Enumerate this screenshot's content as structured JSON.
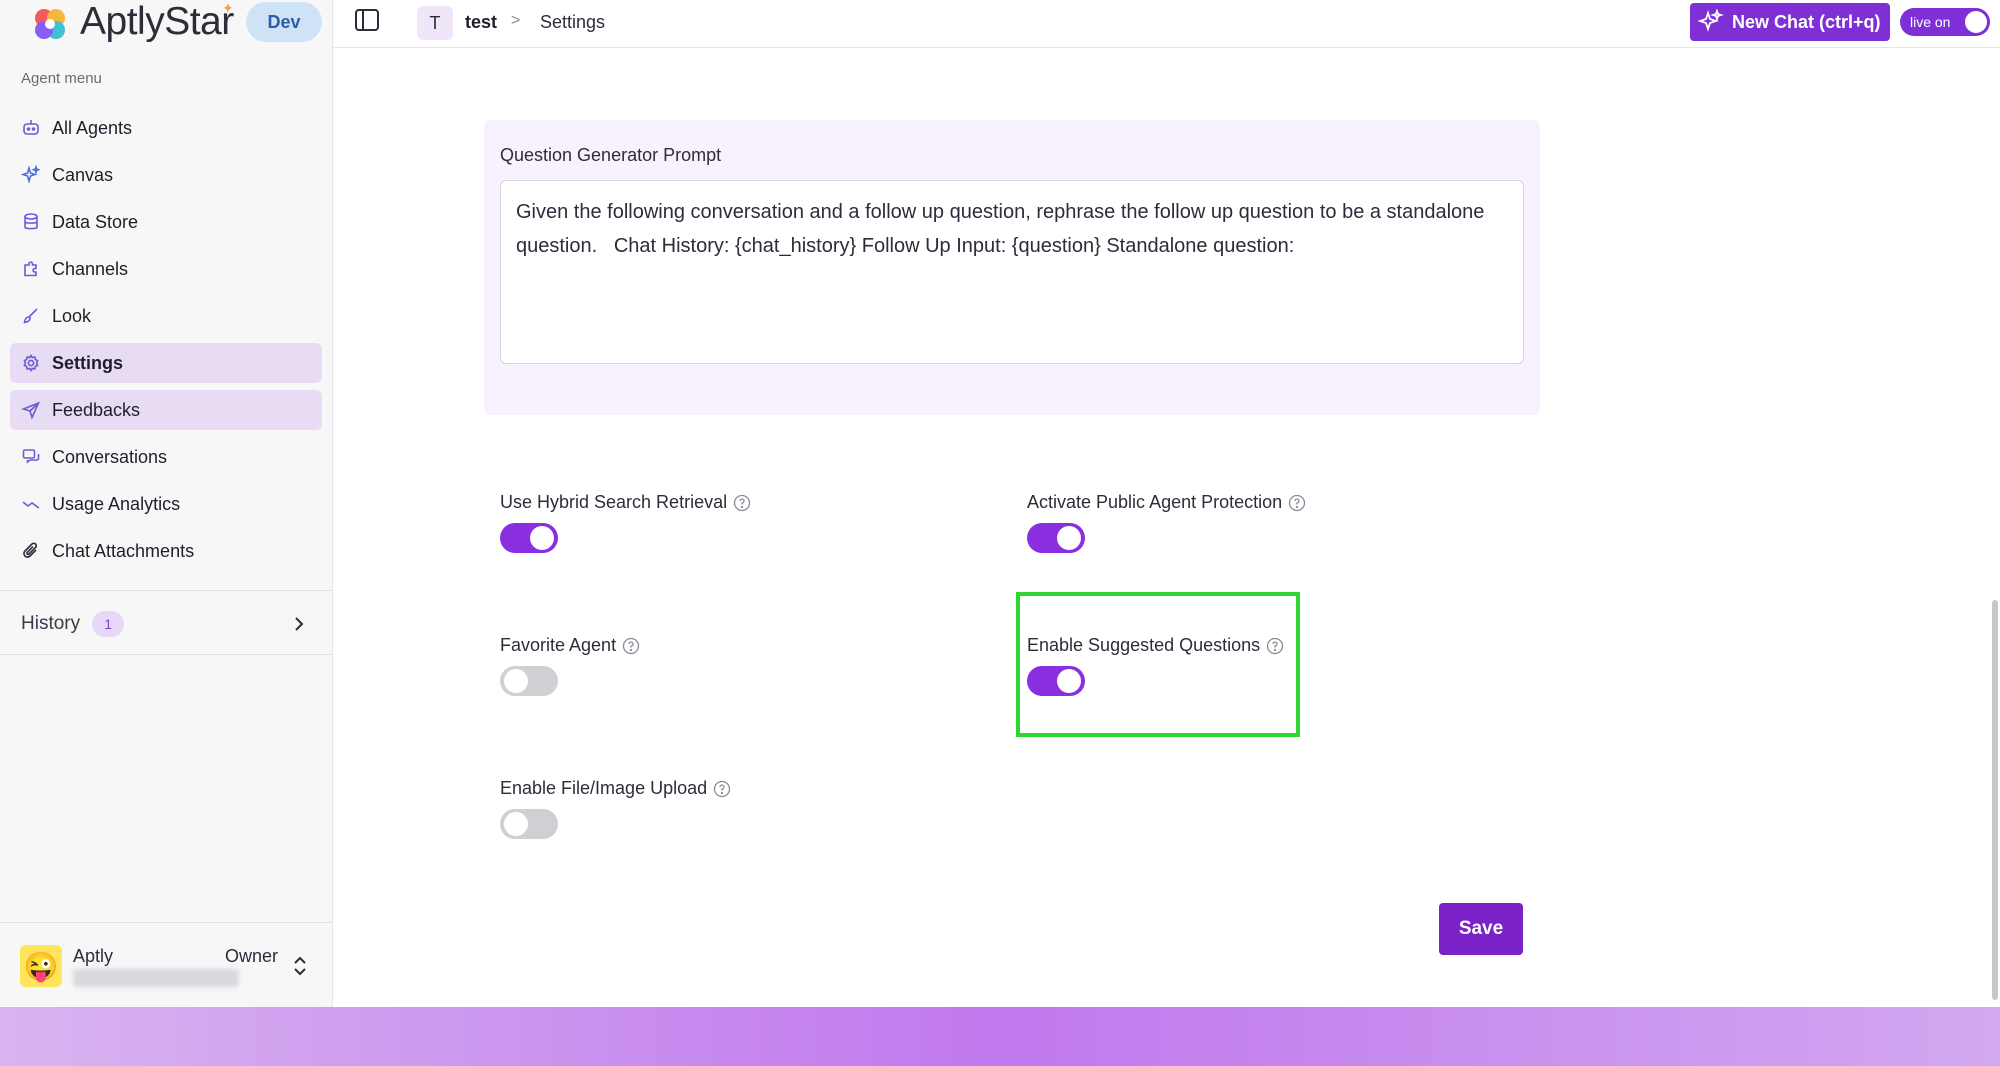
{
  "brand": {
    "name": "AptlyStar",
    "env_badge": "Dev",
    "accent": "#7e2fd6"
  },
  "sidebar": {
    "menu_title": "Agent menu",
    "items": [
      {
        "label": "All Agents",
        "icon": "robot-icon"
      },
      {
        "label": "Canvas",
        "icon": "sparkles-icon"
      },
      {
        "label": "Data Store",
        "icon": "database-icon"
      },
      {
        "label": "Channels",
        "icon": "puzzle-icon"
      },
      {
        "label": "Look",
        "icon": "paintbrush-icon"
      },
      {
        "label": "Settings",
        "icon": "gear-icon"
      },
      {
        "label": "Feedbacks",
        "icon": "send-icon"
      },
      {
        "label": "Conversations",
        "icon": "chat-icon"
      },
      {
        "label": "Usage Analytics",
        "icon": "trend-icon"
      },
      {
        "label": "Chat Attachments",
        "icon": "paperclip-icon"
      }
    ],
    "history": {
      "label": "History",
      "count": "1"
    },
    "user": {
      "name": "Aptly",
      "role": "Owner"
    }
  },
  "header": {
    "crumb_initial": "T",
    "crumb_agent": "test",
    "crumb_separator": ">",
    "crumb_page": "Settings",
    "new_chat_label": "New Chat (ctrl+q)",
    "live_label": "live on"
  },
  "prompt": {
    "label": "Question Generator Prompt",
    "value": "Given the following conversation and a follow up question, rephrase the follow up question to be a standalone question.   Chat History: {chat_history} Follow Up Input: {question} Standalone question:"
  },
  "settings": {
    "hybrid": {
      "label": "Use Hybrid Search Retrieval",
      "on": true
    },
    "protection": {
      "label": "Activate Public Agent Protection",
      "on": true
    },
    "favorite": {
      "label": "Favorite Agent",
      "on": false
    },
    "suggested": {
      "label": "Enable Suggested Questions",
      "on": true
    },
    "upload": {
      "label": "Enable File/Image Upload",
      "on": false
    }
  },
  "save_label": "Save"
}
